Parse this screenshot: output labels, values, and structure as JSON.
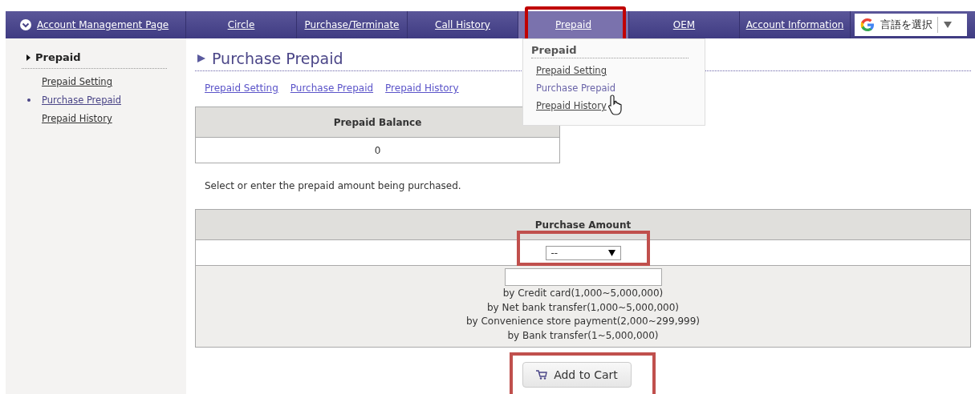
{
  "nav": {
    "tabs": [
      {
        "label": "Account Management Page",
        "selected": false,
        "icon": true
      },
      {
        "label": "Circle",
        "selected": false
      },
      {
        "label": "Purchase/Terminate",
        "selected": false
      },
      {
        "label": "Call History",
        "selected": false
      },
      {
        "label": "Prepaid",
        "selected": true
      },
      {
        "label": "OEM",
        "selected": false
      },
      {
        "label": "Account Information",
        "selected": false
      }
    ],
    "language": {
      "label": "言語を選択"
    }
  },
  "dropdown": {
    "heading": "Prepaid",
    "items": [
      {
        "label": "Prepaid Setting",
        "hovered": false
      },
      {
        "label": "Purchase Prepaid",
        "hovered": true
      },
      {
        "label": "Prepaid History",
        "hovered": false
      }
    ]
  },
  "sidebar": {
    "heading": "Prepaid",
    "items": [
      {
        "label": "Prepaid Setting",
        "selected": false
      },
      {
        "label": "Purchase Prepaid",
        "selected": true
      },
      {
        "label": "Prepaid History",
        "selected": false
      }
    ]
  },
  "main": {
    "title": "Purchase Prepaid",
    "links": [
      "Prepaid Setting",
      "Purchase Prepaid",
      "Prepaid History"
    ],
    "balance": {
      "heading": "Prepaid Balance",
      "value": "0"
    },
    "instruction": "Select or enter the prepaid amount being purchased.",
    "purchase": {
      "heading": "Purchase Amount",
      "select_value": "--",
      "methods": [
        "by Credit card(1,000~5,000,000)",
        "by Net bank transfer(1,000~5,000,000)",
        "by Convenience store payment(2,000~299,999)",
        "by Bank transfer(1~5,000,000)"
      ]
    },
    "button": "Add to Cart"
  }
}
